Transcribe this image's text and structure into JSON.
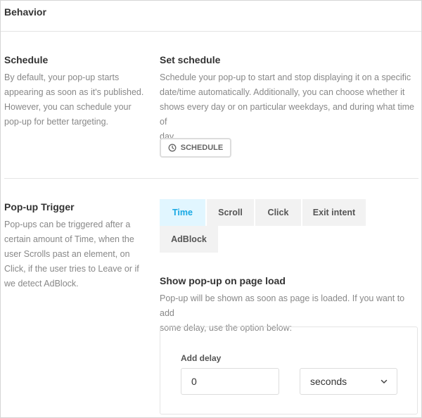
{
  "header": {
    "title": "Behavior"
  },
  "schedule": {
    "title": "Schedule",
    "description_lines": [
      "By default, your pop-up starts",
      "appearing as soon as it's published.",
      "However, you can schedule your",
      "pop-up for better targeting."
    ],
    "set_title": "Set schedule",
    "set_description_lines": [
      "Schedule your pop-up to start and stop displaying it on a specific",
      "date/time automatically. Additionally, you can choose whether it",
      "shows every day or on particular weekdays, and during what time of",
      "day."
    ],
    "button_label": "SCHEDULE",
    "button_icon": "clock-icon"
  },
  "trigger": {
    "title": "Pop-up Trigger",
    "description_lines": [
      "Pop-ups can be triggered after a",
      "certain amount of Time, when the",
      "user Scrolls past an element, on",
      "Click, if the user tries to Leave or if",
      "we detect AdBlock."
    ],
    "tabs": [
      "Time",
      "Scroll",
      "Click",
      "Exit intent",
      "AdBlock"
    ],
    "active_tab": "Time",
    "active_color": "#17a8e3",
    "load_title": "Show pop-up on page load",
    "load_description_lines": [
      "Pop-up will be shown as soon as page is loaded. If you want to add",
      "some delay, use the option below:"
    ],
    "delay_label": "Add delay",
    "delay_value": "0",
    "delay_unit": "seconds"
  }
}
